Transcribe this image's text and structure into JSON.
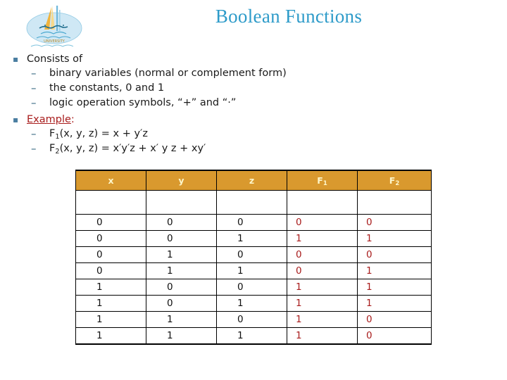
{
  "slide": {
    "title": "Boolean Functions",
    "title_color": "#2e9bc9",
    "logo_name": "university-logo"
  },
  "content": {
    "bullet_glyph": "▪",
    "dash_glyph": "–",
    "bullet_color": "#4a7ea1",
    "item1": {
      "label": "Consists of",
      "subitems": [
        "binary variables (normal or complement form)",
        "the constants, 0 and 1",
        "logic operation symbols, “+” and “·”"
      ]
    },
    "item2": {
      "label": "Example",
      "label_colon": ":",
      "label_color": "#a81c1c",
      "formula1": {
        "name": "F",
        "sub": "1",
        "rest": "(x, y, z) = x + y′z"
      },
      "formula2": {
        "name": "F",
        "sub": "2",
        "rest": "(x, y, z) = x′y′z + x′ y z + xy′"
      }
    }
  },
  "table": {
    "header_bg": "#d9992e",
    "header_fg": "#fdf6c9",
    "value_color": "#111111",
    "function_color": "#a81c1c",
    "headers": [
      {
        "name": "x",
        "sub": ""
      },
      {
        "name": "y",
        "sub": ""
      },
      {
        "name": "z",
        "sub": ""
      },
      {
        "name": "F",
        "sub": "1"
      },
      {
        "name": "F",
        "sub": "2"
      }
    ],
    "spacer_row": [
      "",
      "",
      "",
      "",
      ""
    ],
    "rows": [
      {
        "x": "0",
        "y": "0",
        "z": "0",
        "f1": "0",
        "f2": "0"
      },
      {
        "x": "0",
        "y": "0",
        "z": "1",
        "f1": "1",
        "f2": "1"
      },
      {
        "x": "0",
        "y": "1",
        "z": "0",
        "f1": "0",
        "f2": "0"
      },
      {
        "x": "0",
        "y": "1",
        "z": "1",
        "f1": "0",
        "f2": "1"
      },
      {
        "x": "1",
        "y": "0",
        "z": "0",
        "f1": "1",
        "f2": "1"
      },
      {
        "x": "1",
        "y": "0",
        "z": "1",
        "f1": "1",
        "f2": "1"
      },
      {
        "x": "1",
        "y": "1",
        "z": "0",
        "f1": "1",
        "f2": "0"
      },
      {
        "x": "1",
        "y": "1",
        "z": "1",
        "f1": "1",
        "f2": "0"
      }
    ]
  }
}
